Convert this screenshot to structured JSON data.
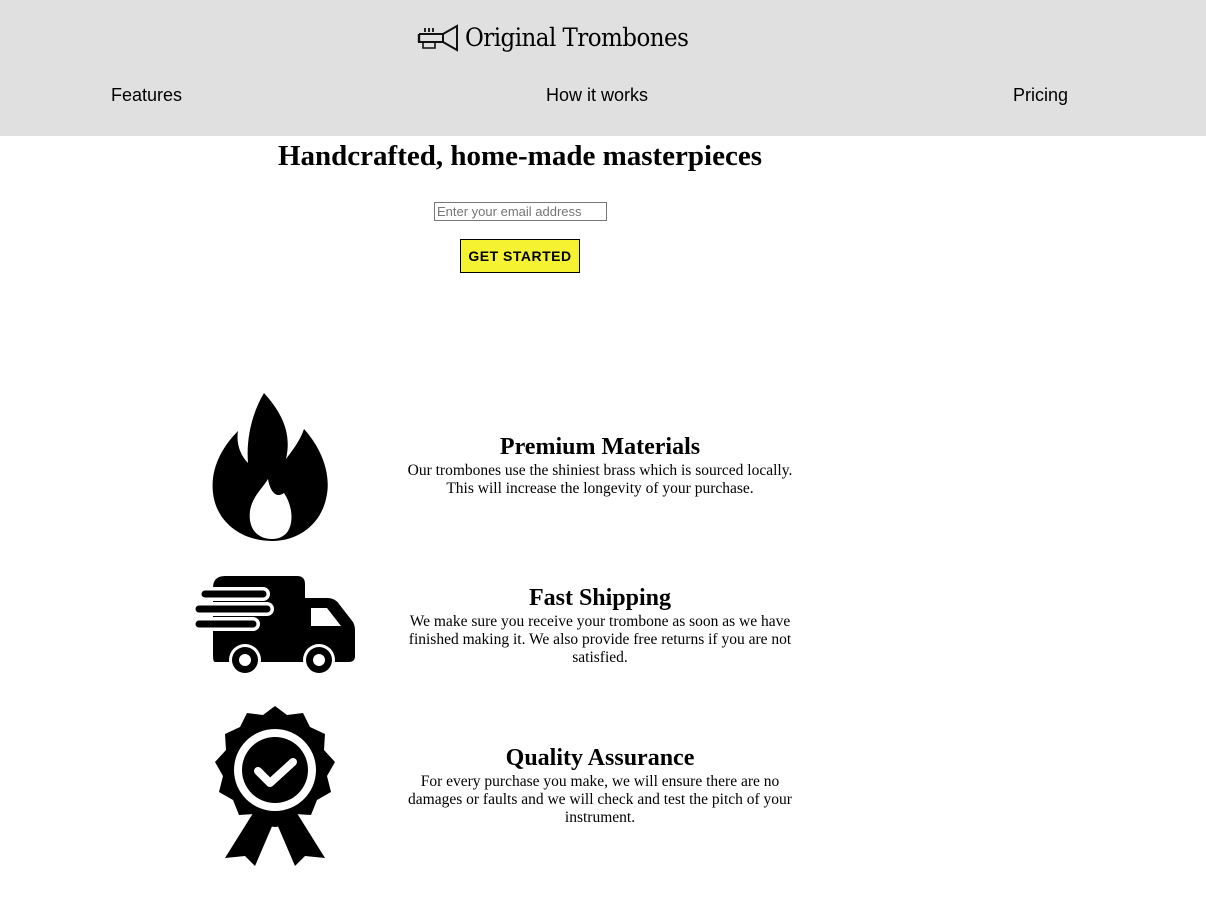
{
  "header": {
    "logo_text": "Original Trombones",
    "nav": {
      "features": "Features",
      "how_it_works": "How it works",
      "pricing": "Pricing"
    }
  },
  "hero": {
    "title": "Handcrafted, home-made masterpieces",
    "email_placeholder": "Enter your email address",
    "email_value": "",
    "cta_label": "GET STARTED",
    "cta_color": "#f5f232"
  },
  "features": [
    {
      "icon": "fire-icon",
      "title": "Premium Materials",
      "description": "Our trombones use the shiniest brass which is sourced locally. This will increase the longevity of your purchase."
    },
    {
      "icon": "truck-icon",
      "title": "Fast Shipping",
      "description": "We make sure you receive your trombone as soon as we have finished making it. We also provide free returns if you are not satisfied."
    },
    {
      "icon": "badge-check-icon",
      "title": "Quality Assurance",
      "description": "For every purchase you make, we will ensure there are no damages or faults and we will check and test the pitch of your instrument."
    }
  ]
}
